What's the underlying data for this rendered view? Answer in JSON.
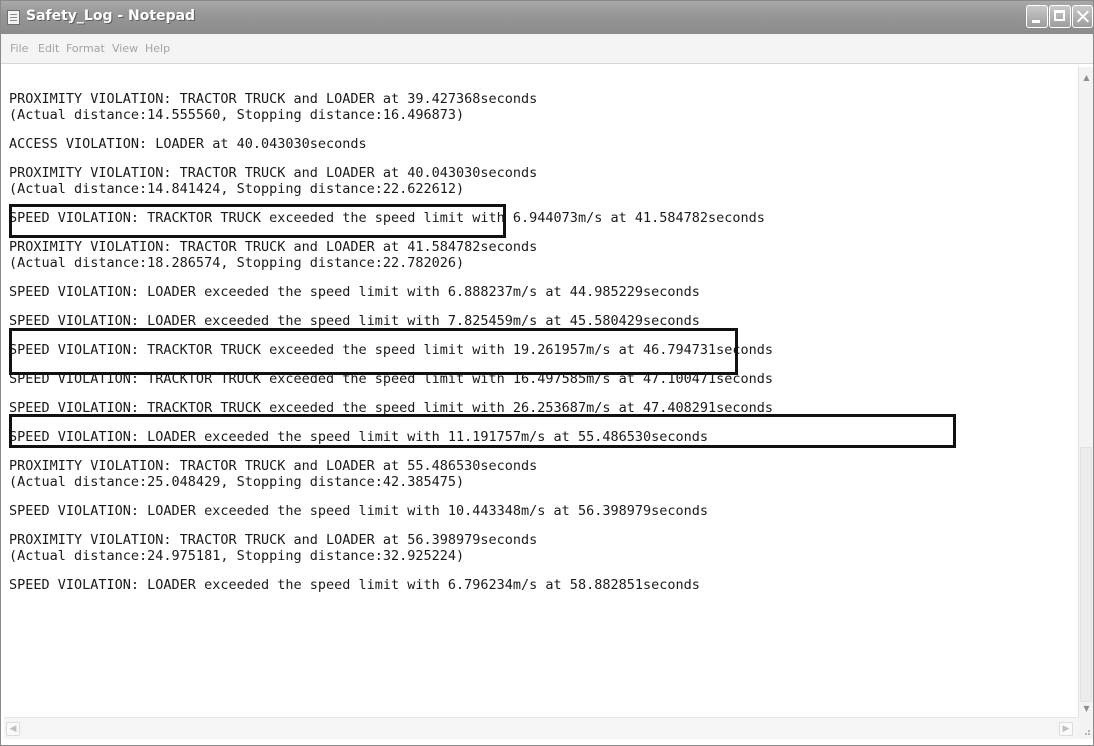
{
  "window": {
    "title": "Safety_Log - Notepad"
  },
  "menu": {
    "file": "File",
    "edit": "Edit",
    "format": "Format",
    "view": "View",
    "help": "Help"
  },
  "icons": {
    "app": "notepad-icon",
    "minimize": "minimize-icon",
    "maximize": "maximize-icon",
    "close": "close-icon"
  },
  "log": {
    "entries": [
      [
        "PROXIMITY VIOLATION: TRACTOR TRUCK and LOADER at 39.427368seconds",
        "(Actual distance:14.555560, Stopping distance:16.496873)"
      ],
      [
        "ACCESS VIOLATION: LOADER at 40.043030seconds"
      ],
      [
        "PROXIMITY VIOLATION: TRACTOR TRUCK and LOADER at 40.043030seconds",
        "(Actual distance:14.841424, Stopping distance:22.622612)"
      ],
      [
        "SPEED VIOLATION: TRACKTOR TRUCK exceeded the speed limit with 6.944073m/s at 41.584782seconds"
      ],
      [
        "PROXIMITY VIOLATION: TRACTOR TRUCK and LOADER at 41.584782seconds",
        "(Actual distance:18.286574, Stopping distance:22.782026)"
      ],
      [
        "SPEED VIOLATION: LOADER exceeded the speed limit with 6.888237m/s at 44.985229seconds"
      ],
      [
        "SPEED VIOLATION: LOADER exceeded the speed limit with 7.825459m/s at 45.580429seconds"
      ],
      [
        "SPEED VIOLATION: TRACKTOR TRUCK exceeded the speed limit with 19.261957m/s at 46.794731seconds"
      ],
      [
        "SPEED VIOLATION: TRACKTOR TRUCK exceeded the speed limit with 16.497585m/s at 47.100471seconds"
      ],
      [
        "SPEED VIOLATION: TRACKTOR TRUCK exceeded the speed limit with 26.253687m/s at 47.408291seconds"
      ],
      [
        "SPEED VIOLATION: LOADER exceeded the speed limit with 11.191757m/s at 55.486530seconds"
      ],
      [
        "PROXIMITY VIOLATION: TRACTOR TRUCK and LOADER at 55.486530seconds",
        "(Actual distance:25.048429, Stopping distance:42.385475)"
      ],
      [
        "SPEED VIOLATION: LOADER exceeded the speed limit with 10.443348m/s at 56.398979seconds"
      ],
      [
        "PROXIMITY VIOLATION: TRACTOR TRUCK and LOADER at 56.398979seconds",
        "(Actual distance:24.975181, Stopping distance:32.925224)"
      ],
      [
        "SPEED VIOLATION: LOADER exceeded the speed limit with 6.796234m/s at 58.882851seconds"
      ]
    ],
    "highlighted_entries": [
      1,
      4,
      6
    ]
  }
}
